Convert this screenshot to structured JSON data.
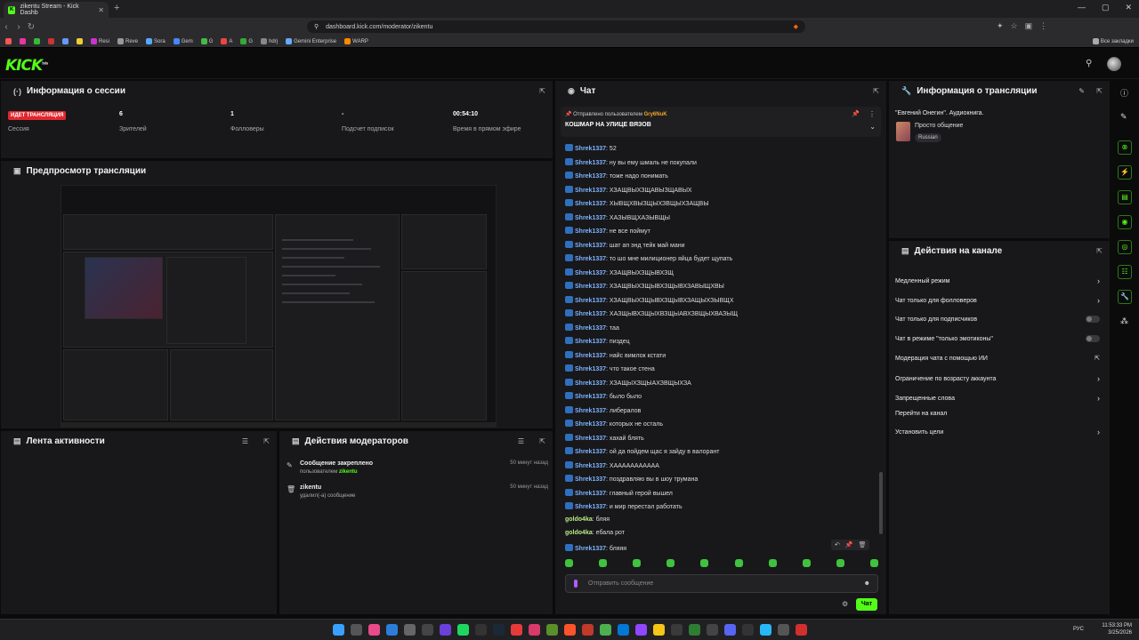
{
  "browser": {
    "tab_title": "zikentu Stream - Kick Dashb",
    "url": "dashboard.kick.com/moderator/zikentu",
    "bookmarks": [
      "Resi",
      "Reve",
      "Sora",
      "Gem",
      "G",
      "A",
      "G",
      "hdrj",
      "Gemini Enterprise",
      "WARP",
      "Все закладки"
    ]
  },
  "kick": {
    "logo": "KICK",
    "logo_sup": "beta"
  },
  "session": {
    "title": "Информация о сессии",
    "live_badge": "ИДЕТ ТРАНСЛЯЦИЯ",
    "stats": [
      {
        "value": "6",
        "label": "Зрителей"
      },
      {
        "value": "1",
        "label": "Фолловеры"
      },
      {
        "value": "-",
        "label": "Подсчет подписок"
      },
      {
        "value": "00:54:10",
        "label": "Время в прямом эфире"
      }
    ],
    "session_label": "Сессия"
  },
  "preview": {
    "title": "Предпросмотр трансляции"
  },
  "activity": {
    "title": "Лента активности"
  },
  "mod": {
    "title": "Действия модераторов",
    "items": [
      {
        "title": "Сообщение закреплено",
        "sub": "пользователем",
        "user": "zikentu",
        "time": "50 минут назад"
      },
      {
        "title": "zikentu",
        "sub": "удалил(-а) сообщение",
        "user": "",
        "time": "50 минут назад"
      }
    ]
  },
  "chat": {
    "title": "Чат",
    "pinned_by": "Отправлено пользователем",
    "pinned_user": "Gry6NuK",
    "pinned_text": "КОШМАР НА УЛИЦЕ ВЯЗОВ",
    "messages": [
      {
        "user": "Shrek1337",
        "text": "52",
        "badge": true
      },
      {
        "user": "Shrek1337",
        "text": "ну вы ему шмаль не покупали",
        "badge": true
      },
      {
        "user": "Shrek1337",
        "text": "тоже надо понимать",
        "badge": true
      },
      {
        "user": "Shrek1337",
        "text": "ХЗАЩВЫХЗЩАВЫЗЩАВЫХ",
        "badge": true
      },
      {
        "user": "Shrek1337",
        "text": "ХЫВЩХВЫЗЩЫХЗВЩЫХЗАЩВЫ",
        "badge": true
      },
      {
        "user": "Shrek1337",
        "text": "ХАЗЫВЩХАЗЫВЩЫ",
        "badge": true
      },
      {
        "user": "Shrek1337",
        "text": "не все поймут",
        "badge": true
      },
      {
        "user": "Shrek1337",
        "text": "шат ап энд тейк май мани",
        "badge": true
      },
      {
        "user": "Shrek1337",
        "text": "то шо мне милиционер яйца будет щупать",
        "badge": true
      },
      {
        "user": "Shrek1337",
        "text": "ХЗАЩВЫХЗЩЫВХЗЩ",
        "badge": true
      },
      {
        "user": "Shrek1337",
        "text": "ХЗАЩВЫХЗЩЫВХЗЩЫВХЗАВЫЩХВЫ",
        "badge": true
      },
      {
        "user": "Shrek1337",
        "text": "ХЗАЩВЫХЗЩЫВХЗЩЫВХЗАЩЫХЗЫВЩХ",
        "badge": true
      },
      {
        "user": "Shrek1337",
        "text": "ХАЗЩЫВХЗЩЫХВЗЩЫАВХЗВЩЫХВАЗЫЩ",
        "badge": true
      },
      {
        "user": "Shrek1337",
        "text": "таа",
        "badge": true
      },
      {
        "user": "Shrek1337",
        "text": "пиздец",
        "badge": true
      },
      {
        "user": "Shrek1337",
        "text": "найс вимлок кстати",
        "badge": true
      },
      {
        "user": "Shrek1337",
        "text": "что такое стена",
        "badge": true
      },
      {
        "user": "Shrek1337",
        "text": "ХЗАЩЫХЗЩЫАХЗВЩЫХЗА",
        "badge": true
      },
      {
        "user": "Shrek1337",
        "text": "было было",
        "badge": true
      },
      {
        "user": "Shrek1337",
        "text": "либералов",
        "badge": true
      },
      {
        "user": "Shrek1337",
        "text": "которых не осталь",
        "badge": true
      },
      {
        "user": "Shrek1337",
        "text": "хахай блять",
        "badge": true
      },
      {
        "user": "Shrek1337",
        "text": "ой да пойдем щас я зайду в валорант",
        "badge": true
      },
      {
        "user": "Shrek1337",
        "text": "ХААААААААААА",
        "badge": true
      },
      {
        "user": "Shrek1337",
        "text": "поздравляю вы в шоу трумана",
        "badge": true
      },
      {
        "user": "Shrek1337",
        "text": "главный герой вышел",
        "badge": true
      },
      {
        "user": "Shrek1337",
        "text": "и мир перестал работать",
        "badge": true
      },
      {
        "user": "goldo4ka",
        "text": "бляя",
        "badge": false
      },
      {
        "user": "goldo4ka",
        "text": "ебала рот",
        "badge": false
      },
      {
        "user": "Shrek1337",
        "text": "бляяя",
        "badge": true
      }
    ],
    "input_placeholder": "Отправить сообщение",
    "send_label": "Чат"
  },
  "stream_info": {
    "title": "Информация о трансляции",
    "stream_title": "\"Евгений Онегин\". Аудиокнига.",
    "category": "Просто общение",
    "language": "Russian"
  },
  "channel_actions": {
    "title": "Действия на канале",
    "items": [
      {
        "label": "Медленный режим",
        "control": "chevron"
      },
      {
        "label": "Чат только для фолловеров",
        "control": "chevron"
      },
      {
        "label": "Чат только для подписчиков",
        "control": "toggle"
      },
      {
        "label": "Чат в режиме \"только эмотиконы\"",
        "control": "toggle"
      },
      {
        "label": "Модерация чата с помощью ИИ",
        "control": "external"
      },
      {
        "label": "Ограничение по возрасту аккаунта",
        "control": "chevron"
      },
      {
        "label": "Запрещенные слова",
        "control": "chevron"
      },
      {
        "label": "Перейти на канал",
        "control": "none"
      },
      {
        "label": "Установить цели",
        "control": "chevron"
      }
    ]
  },
  "taskbar": {
    "lang": "РУС",
    "time": "11:53:33 PM",
    "date": "3/25/2026"
  },
  "colors": {
    "accent": "#53fc18",
    "live": "#e0272e",
    "panel": "#18181a",
    "background": "#0b0b0c"
  }
}
